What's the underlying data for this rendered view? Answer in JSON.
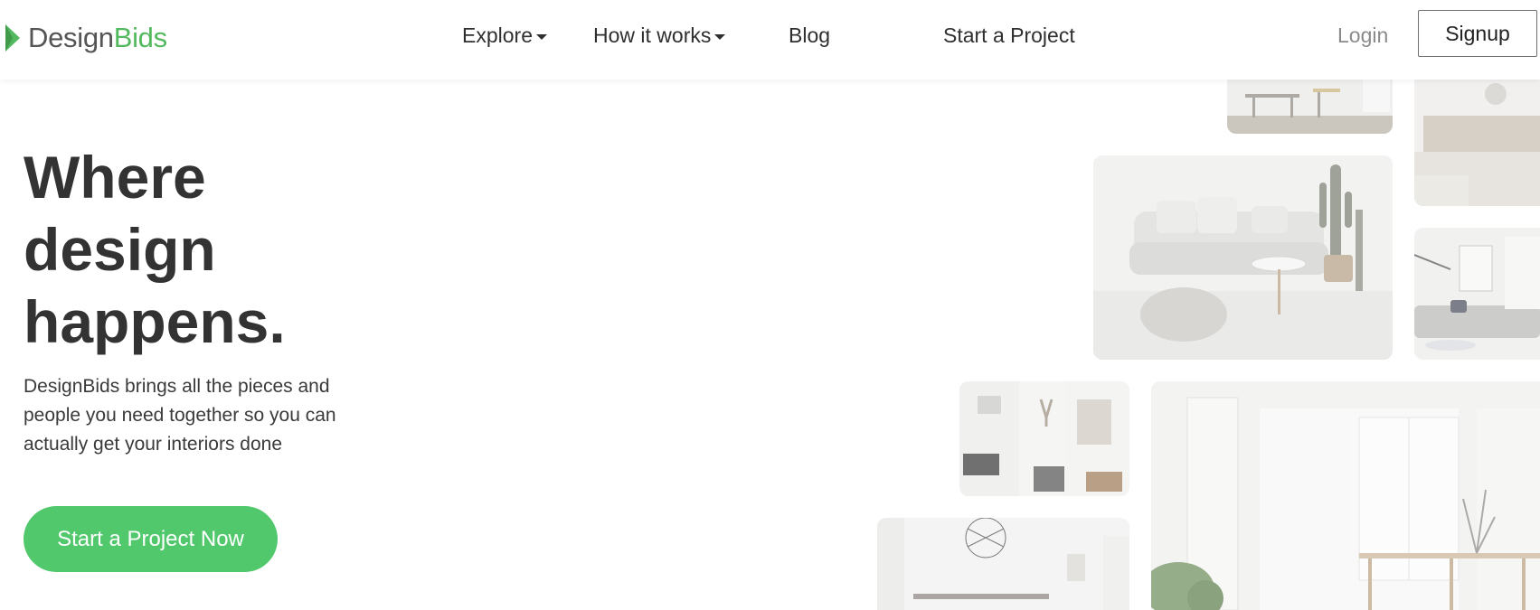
{
  "header": {
    "logo": {
      "prefix": "Design",
      "accent": "Bids"
    },
    "nav": [
      {
        "label": "Explore",
        "dropdown": true
      },
      {
        "label": "How it works",
        "dropdown": true
      },
      {
        "label": "Blog",
        "dropdown": false
      },
      {
        "label": "Start a Project",
        "dropdown": false
      }
    ],
    "login": "Login",
    "signup": "Signup"
  },
  "hero": {
    "title_lines": [
      "Where",
      "design",
      "happens."
    ],
    "subtitle_lines": [
      "DesignBids brings all the pieces and",
      "people you need together so you can",
      "actually get your interiors done"
    ],
    "cta": "Start a Project Now"
  },
  "colors": {
    "brand_green": "#53b95f",
    "cta_green": "#52c86c",
    "text_dark": "#333333",
    "login_gray": "#8a8a8a"
  },
  "collage": [
    "dining-room-photo",
    "living-room-rug-photo",
    "white-sofa-cactus-photo",
    "sofa-lamp-photo",
    "fireplace-antlers-photo",
    "bright-dining-room-photo",
    "kitchen-chandelier-photo"
  ]
}
